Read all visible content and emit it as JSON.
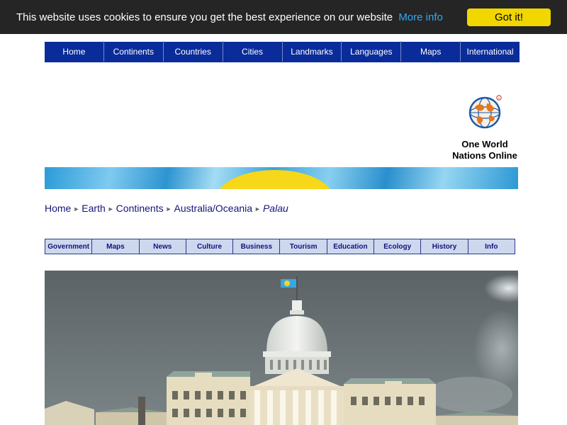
{
  "cookie": {
    "message": "This website uses cookies to ensure you get the best experience on our website",
    "more_info": "More info",
    "accept": "Got it!"
  },
  "main_nav": [
    "Home",
    "Continents",
    "Countries",
    "Cities",
    "Landmarks",
    "Languages",
    "Maps",
    "International"
  ],
  "logo": {
    "line1": "One World",
    "line2": "Nations Online",
    "icon": "globe-at-icon"
  },
  "breadcrumb": {
    "items": [
      "Home",
      "Earth",
      "Continents",
      "Australia/Oceania"
    ],
    "current": "Palau"
  },
  "sub_nav": [
    "Government",
    "Maps",
    "News",
    "Culture",
    "Business",
    "Tourism",
    "Education",
    "Ecology",
    "History",
    "Info"
  ],
  "colors": {
    "nav_bg": "#0a2c9a",
    "cookie_bg": "#252525",
    "cookie_button": "#f1d600",
    "link": "#31a8f0",
    "flag_blue": "#2b9bd8",
    "flag_yellow": "#f6d71a"
  }
}
